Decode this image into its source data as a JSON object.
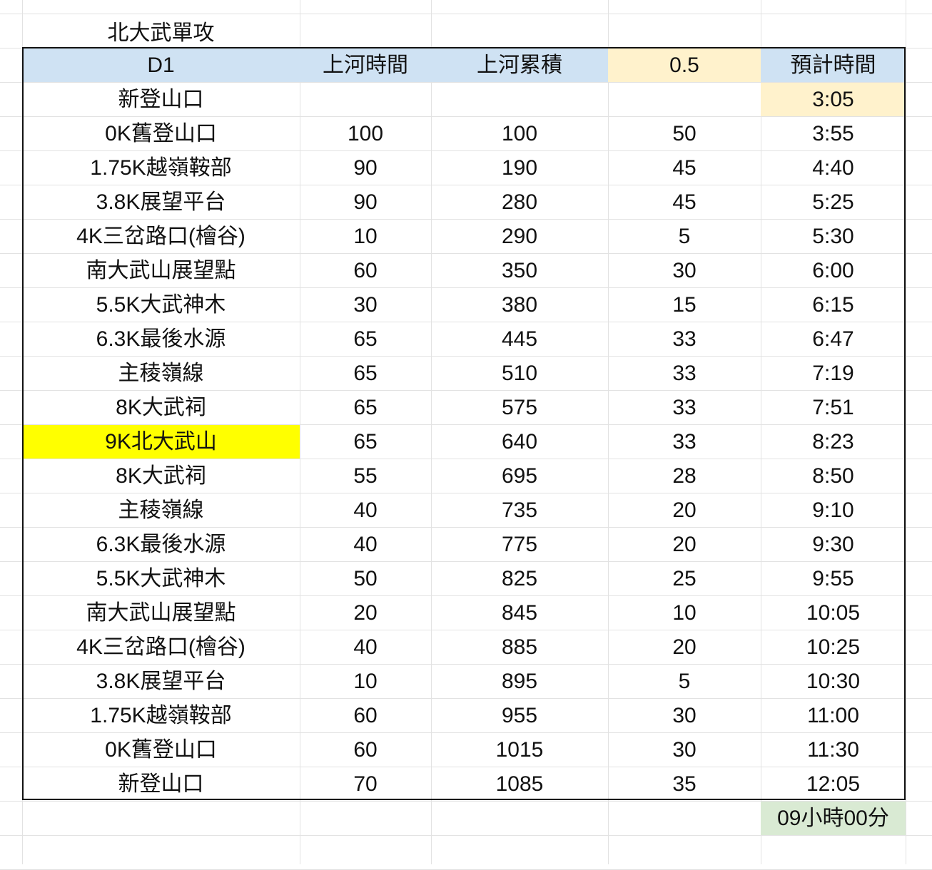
{
  "sheet": {
    "title": "北大武單攻",
    "headers": {
      "col_a": "D1",
      "col_b": "上河時間",
      "col_c": "上河累積",
      "col_d": "0.5",
      "col_e": "預計時間"
    },
    "rows": [
      {
        "a": "新登山口",
        "b": "",
        "c": "",
        "d": "",
        "e": "3:05"
      },
      {
        "a": "0K舊登山口",
        "b": "100",
        "c": "100",
        "d": "50",
        "e": "3:55"
      },
      {
        "a": "1.75K越嶺鞍部",
        "b": "90",
        "c": "190",
        "d": "45",
        "e": "4:40"
      },
      {
        "a": "3.8K展望平台",
        "b": "90",
        "c": "280",
        "d": "45",
        "e": "5:25"
      },
      {
        "a": "4K三岔路口(檜谷)",
        "b": "10",
        "c": "290",
        "d": "5",
        "e": "5:30"
      },
      {
        "a": "南大武山展望點",
        "b": "60",
        "c": "350",
        "d": "30",
        "e": "6:00"
      },
      {
        "a": "5.5K大武神木",
        "b": "30",
        "c": "380",
        "d": "15",
        "e": "6:15"
      },
      {
        "a": "6.3K最後水源",
        "b": "65",
        "c": "445",
        "d": "33",
        "e": "6:47"
      },
      {
        "a": "主稜嶺線",
        "b": "65",
        "c": "510",
        "d": "33",
        "e": "7:19"
      },
      {
        "a": "8K大武祠",
        "b": "65",
        "c": "575",
        "d": "33",
        "e": "7:51"
      },
      {
        "a": "9K北大武山",
        "b": "65",
        "c": "640",
        "d": "33",
        "e": "8:23"
      },
      {
        "a": "8K大武祠",
        "b": "55",
        "c": "695",
        "d": "28",
        "e": "8:50"
      },
      {
        "a": "主稜嶺線",
        "b": "40",
        "c": "735",
        "d": "20",
        "e": "9:10"
      },
      {
        "a": "6.3K最後水源",
        "b": "40",
        "c": "775",
        "d": "20",
        "e": "9:30"
      },
      {
        "a": "5.5K大武神木",
        "b": "50",
        "c": "825",
        "d": "25",
        "e": "9:55"
      },
      {
        "a": "南大武山展望點",
        "b": "20",
        "c": "845",
        "d": "10",
        "e": "10:05"
      },
      {
        "a": "4K三岔路口(檜谷)",
        "b": "40",
        "c": "885",
        "d": "20",
        "e": "10:25"
      },
      {
        "a": "3.8K展望平台",
        "b": "10",
        "c": "895",
        "d": "5",
        "e": "10:30"
      },
      {
        "a": "1.75K越嶺鞍部",
        "b": "60",
        "c": "955",
        "d": "30",
        "e": "11:00"
      },
      {
        "a": "0K舊登山口",
        "b": "60",
        "c": "1015",
        "d": "30",
        "e": "11:30"
      },
      {
        "a": "新登山口",
        "b": "70",
        "c": "1085",
        "d": "35",
        "e": "12:05"
      }
    ],
    "total": "09小時00分",
    "colors": {
      "header_bg": "#cfe2f3",
      "factor_bg": "#fff2cc",
      "start_time_bg": "#fff2cc",
      "summit_bg": "#ffff00",
      "total_bg": "#d9ead3",
      "gridline": "#e2e2e2",
      "border": "#111111"
    }
  }
}
